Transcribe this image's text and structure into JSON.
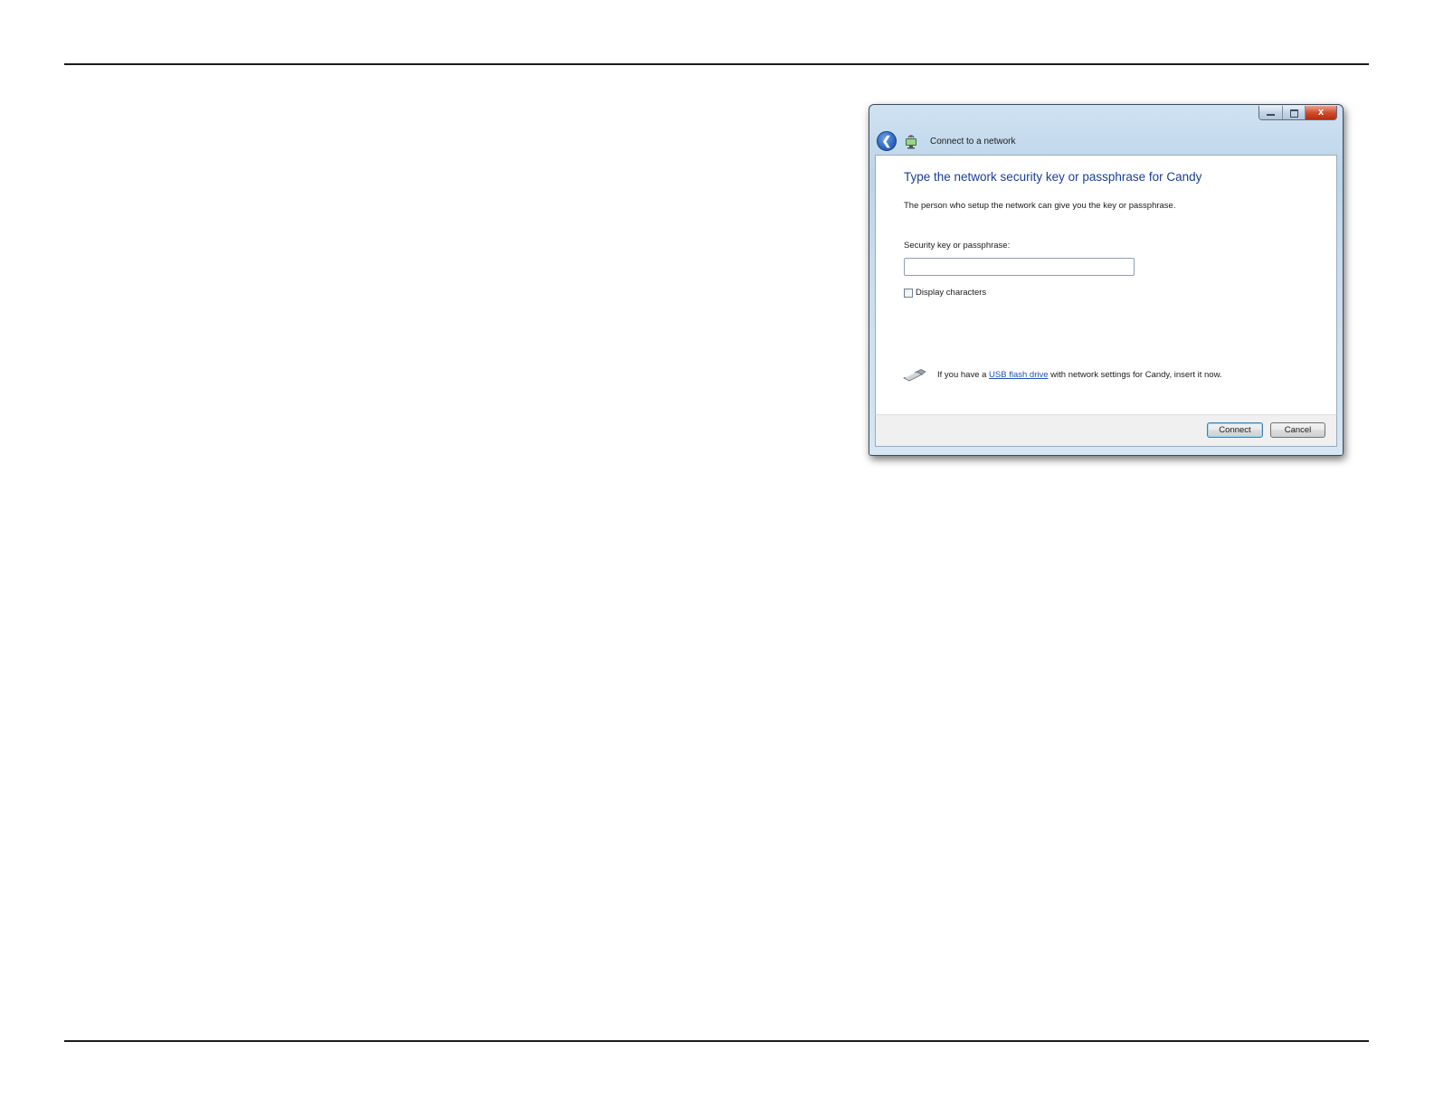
{
  "window": {
    "title": "Connect to a network",
    "close_glyph": "x"
  },
  "nav": {
    "back_glyph": "❮"
  },
  "content": {
    "heading": "Type the network security key or passphrase for Candy",
    "description": "The person who setup the network can give you the key or passphrase.",
    "key_label": "Security key or passphrase:",
    "key_value": "",
    "display_characters_label": "Display characters",
    "display_characters_checked": false,
    "usb_prefix": "If you have a ",
    "usb_link": "USB flash drive",
    "usb_suffix": " with network settings for Candy, insert it now."
  },
  "buttons": {
    "connect": "Connect",
    "cancel": "Cancel"
  },
  "icons": {
    "back": "back-arrow-icon",
    "network": "wireless-network-icon",
    "usb": "usb-flash-drive-icon",
    "minimize": "minimize-icon",
    "maximize": "maximize-icon",
    "close": "close-icon"
  },
  "colors": {
    "heading": "#1a3e95",
    "link": "#1f50b5",
    "close_button": "#d24d2d",
    "title_bar": "#bcd5ea"
  }
}
